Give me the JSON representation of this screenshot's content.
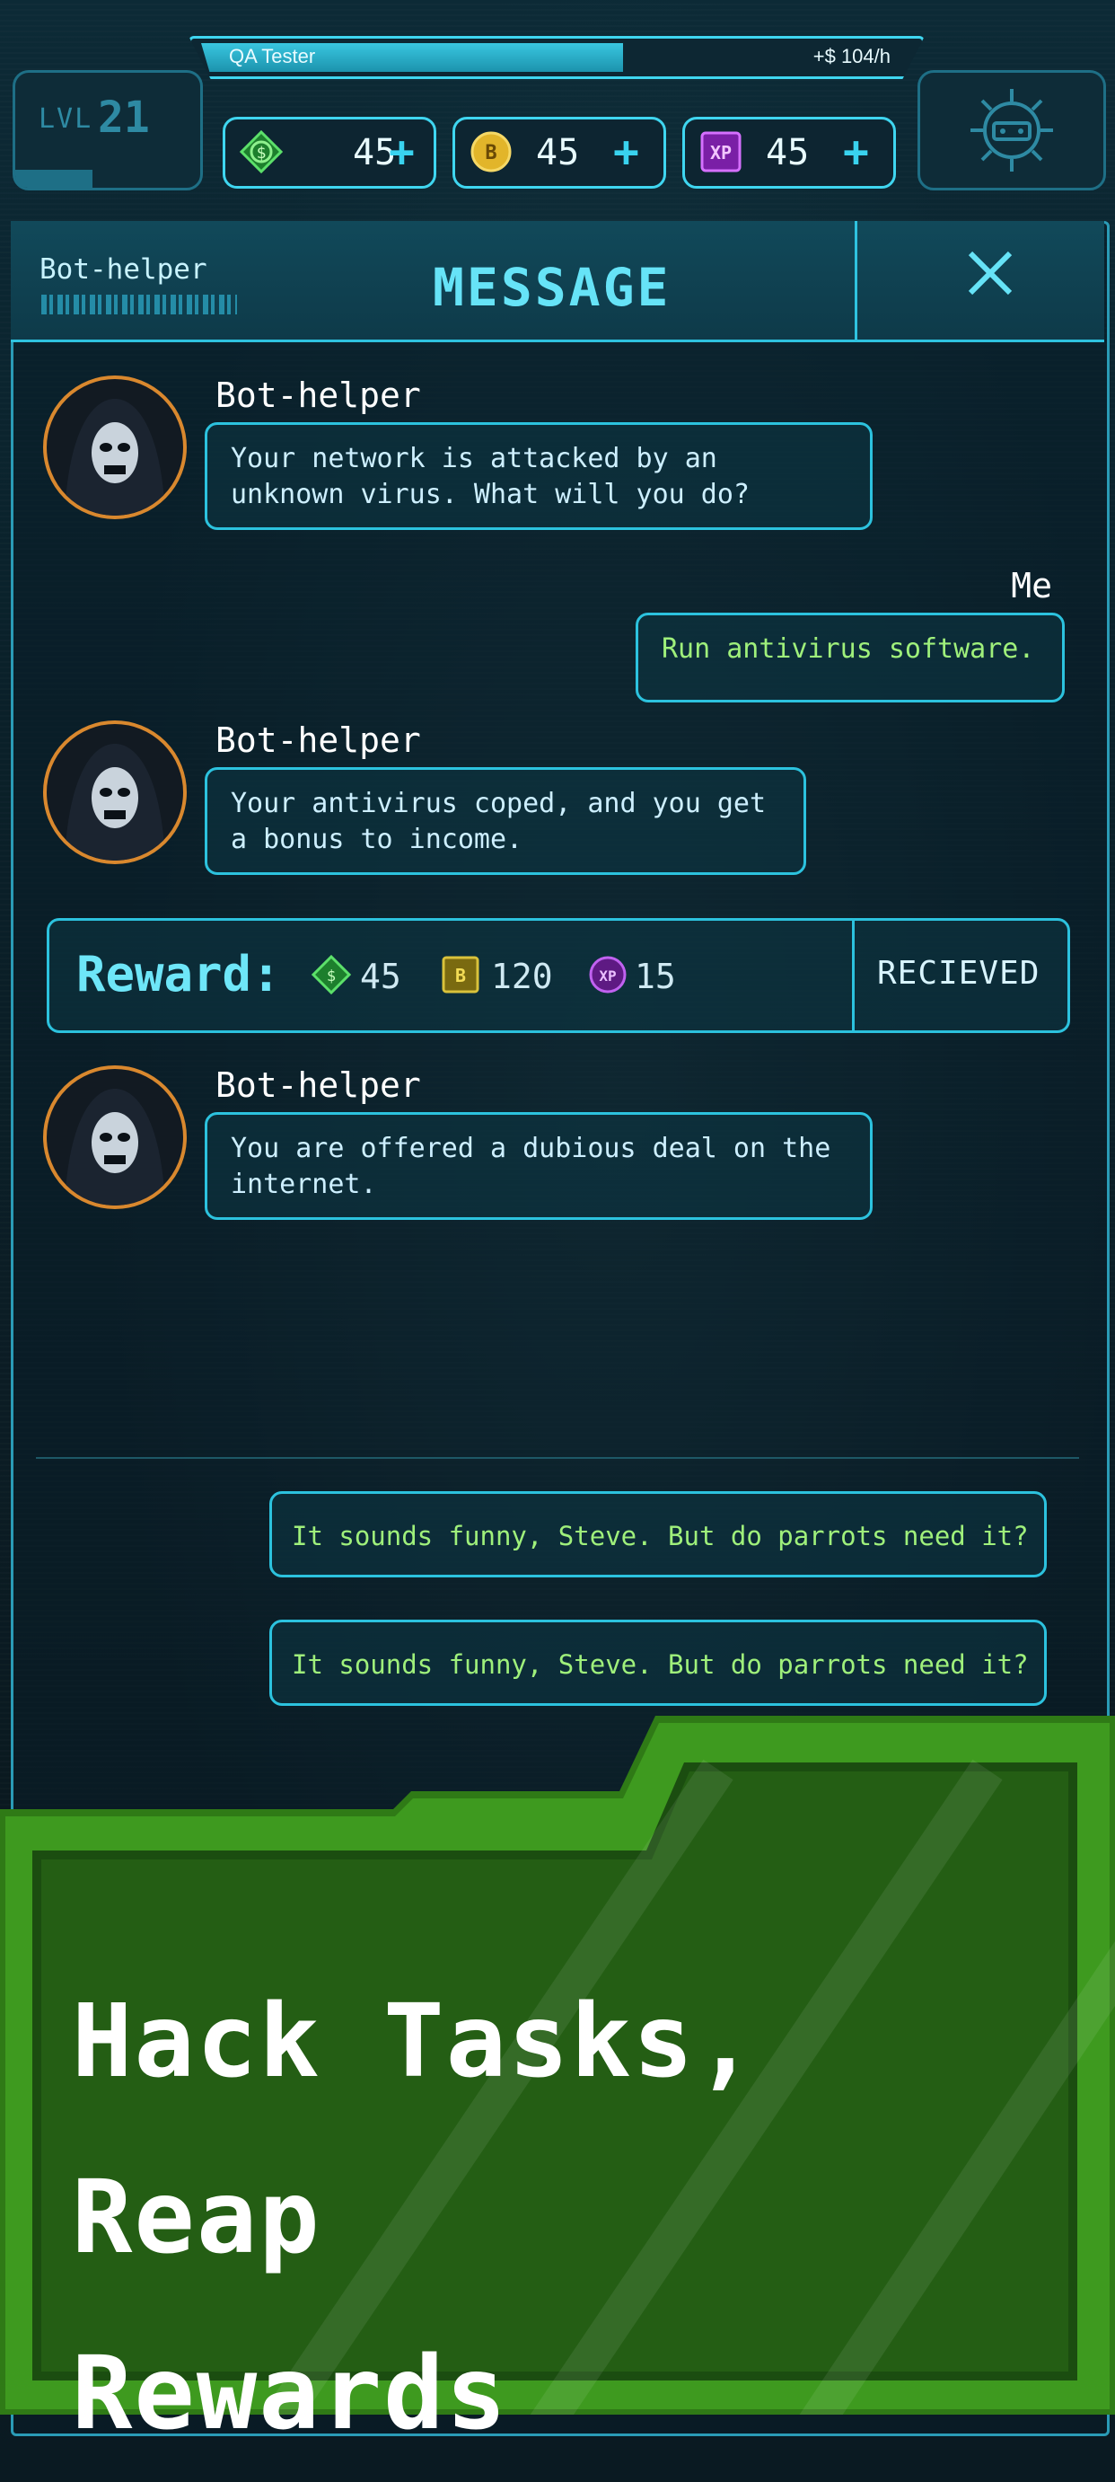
{
  "header": {
    "player_title": "QA Tester",
    "income_rate": "+$ 104/h",
    "level_label": "LVL",
    "level_value": "21"
  },
  "resources": [
    {
      "icon": "dollar-chip-icon",
      "value": "45",
      "plus": "+"
    },
    {
      "icon": "bitcoin-coin-icon",
      "value": "45",
      "plus": "+"
    },
    {
      "icon": "xp-badge-icon",
      "value": "45",
      "plus": "+"
    }
  ],
  "panel": {
    "sender": "Bot-helper",
    "title": "MESSAGE"
  },
  "messages": [
    {
      "from": "Bot-helper",
      "text": "Your network is attacked by an unknown virus. What will you do?"
    },
    {
      "from": "Me",
      "text": "Run antivirus software."
    },
    {
      "from": "Bot-helper",
      "text": "Your antivirus coped, and you get a bonus to income."
    },
    {
      "from": "Bot-helper",
      "text": "You are offered a dubious deal on the internet."
    }
  ],
  "reward": {
    "label": "Reward:",
    "dollars": "45",
    "bitcoin": "120",
    "xp": "15",
    "status": "RECIEVED"
  },
  "options": [
    "It sounds funny, Steve. But do parrots need it?",
    "It sounds funny, Steve. But do parrots need it?"
  ],
  "promo": {
    "line1": "Hack Tasks, Reap",
    "line2": "Rewards"
  },
  "colors": {
    "accent": "#3fd6f0",
    "reply_text": "#9ff07b",
    "avatar_ring": "#d9882e",
    "promo_green": "#2f7a16"
  }
}
